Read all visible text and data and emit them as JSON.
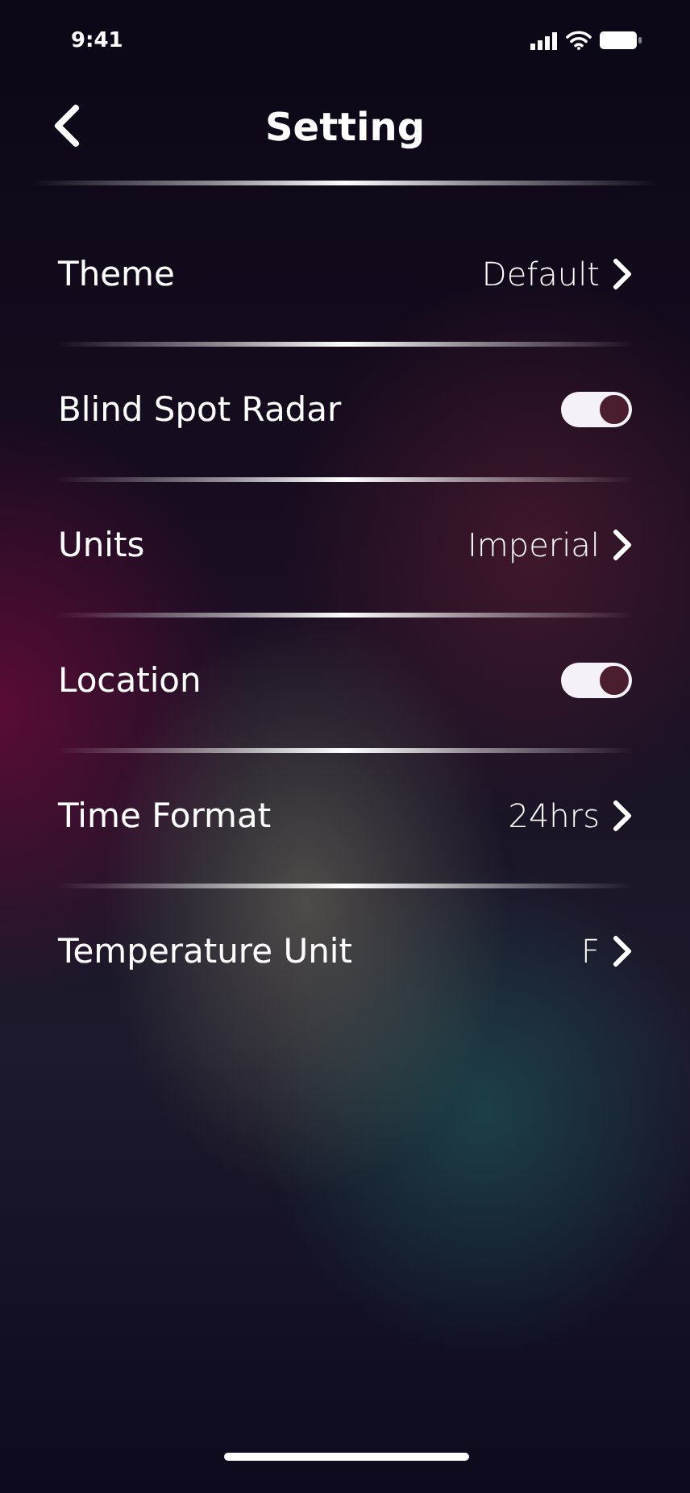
{
  "status_bar": {
    "time": "9:41"
  },
  "header": {
    "title": "Setting"
  },
  "settings": [
    {
      "kind": "link",
      "label": "Theme",
      "value": "Default"
    },
    {
      "kind": "toggle",
      "label": "Blind Spot Radar",
      "on": true
    },
    {
      "kind": "link",
      "label": "Units",
      "value": "Imperial"
    },
    {
      "kind": "toggle",
      "label": "Location",
      "on": true
    },
    {
      "kind": "link",
      "label": "Time Format",
      "value": "24hrs"
    },
    {
      "kind": "link",
      "label": "Temperature Unit",
      "value": "F"
    }
  ]
}
